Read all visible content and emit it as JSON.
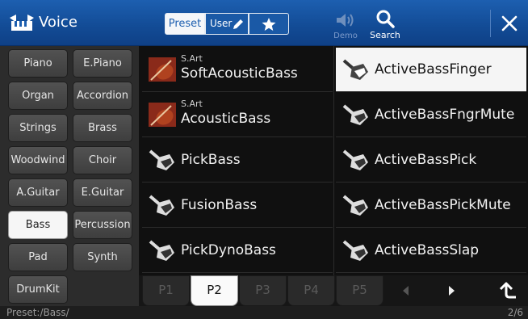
{
  "header": {
    "title": "Voice",
    "tabs": {
      "preset": "Preset",
      "user": "User"
    },
    "demo_label": "Demo",
    "search_label": "Search"
  },
  "categories": [
    {
      "label": "Piano"
    },
    {
      "label": "E.Piano"
    },
    {
      "label": "Organ"
    },
    {
      "label": "Accordion"
    },
    {
      "label": "Strings"
    },
    {
      "label": "Brass"
    },
    {
      "label": "Woodwind"
    },
    {
      "label": "Choir"
    },
    {
      "label": "A.Guitar"
    },
    {
      "label": "E.Guitar"
    },
    {
      "label": "Bass",
      "selected": true
    },
    {
      "label": "Percussion"
    },
    {
      "label": "Pad"
    },
    {
      "label": "Synth"
    },
    {
      "label": "DrumKit"
    }
  ],
  "voices": [
    {
      "name": "SoftAcousticBass",
      "tag": "S.Art",
      "icon": "acoustic-bass-icon"
    },
    {
      "name": "ActiveBassFinger",
      "tag": "",
      "icon": "electric-bass-icon",
      "selected": true
    },
    {
      "name": "AcousticBass",
      "tag": "S.Art",
      "icon": "acoustic-bass-icon"
    },
    {
      "name": "ActiveBassFngrMute",
      "tag": "",
      "icon": "electric-bass-icon"
    },
    {
      "name": "PickBass",
      "tag": "",
      "icon": "electric-bass-icon"
    },
    {
      "name": "ActiveBassPick",
      "tag": "",
      "icon": "electric-bass-icon"
    },
    {
      "name": "FusionBass",
      "tag": "",
      "icon": "electric-bass-icon"
    },
    {
      "name": "ActiveBassPickMute",
      "tag": "",
      "icon": "electric-bass-icon"
    },
    {
      "name": "PickDynoBass",
      "tag": "",
      "icon": "electric-bass-icon"
    },
    {
      "name": "ActiveBassSlap",
      "tag": "",
      "icon": "electric-bass-icon"
    }
  ],
  "pages": [
    "P1",
    "P2",
    "P3",
    "P4",
    "P5"
  ],
  "active_page": "P2",
  "status": {
    "path": "Preset:/Bass/",
    "page_indicator": "2/6"
  },
  "colors": {
    "header": "#1d5fb0",
    "selected": "#f5f5f5"
  }
}
